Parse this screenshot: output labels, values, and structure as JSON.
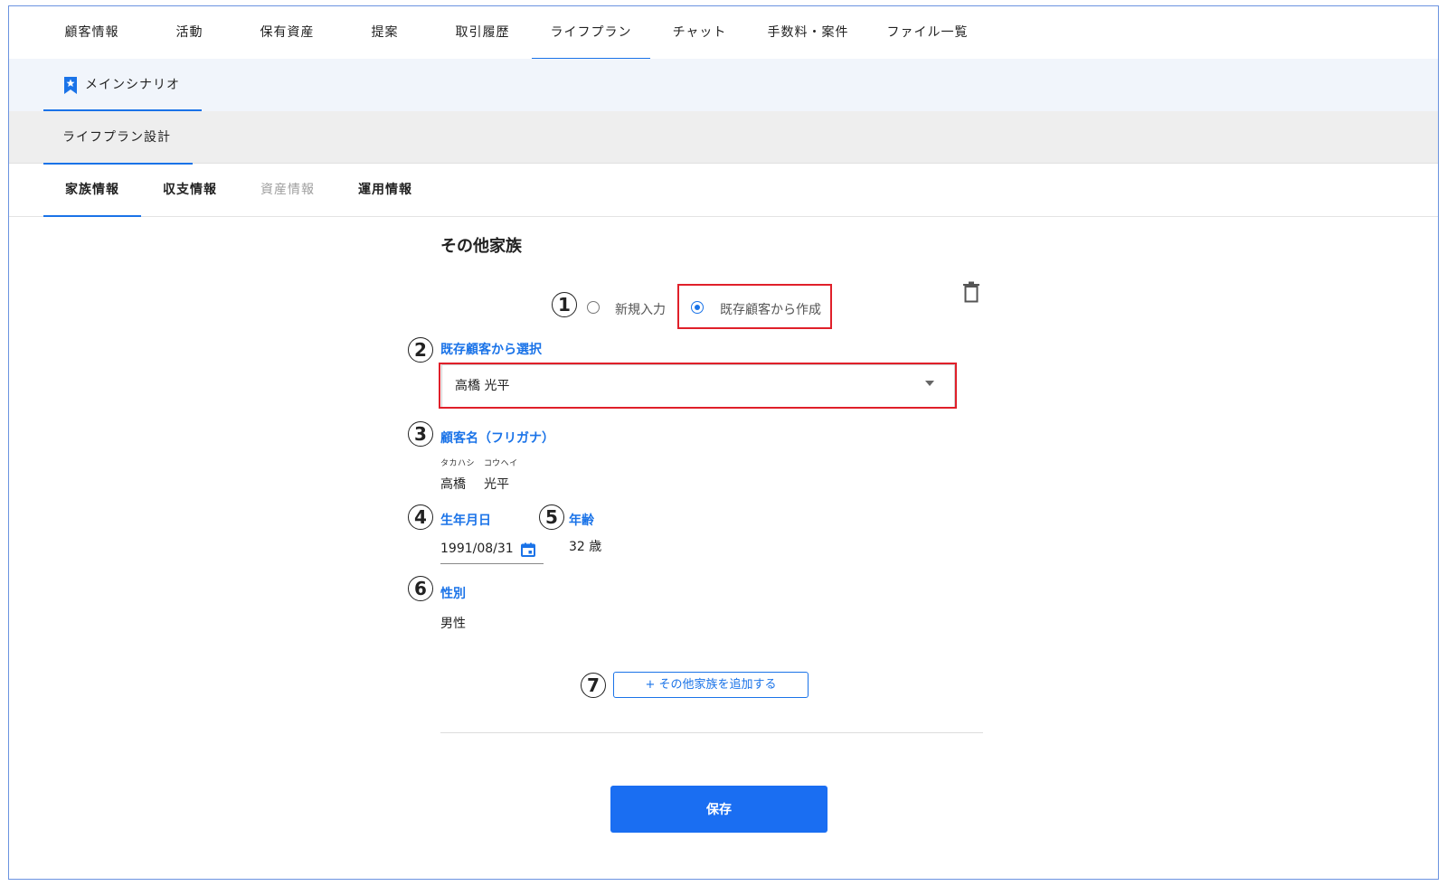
{
  "top_tabs": [
    {
      "label": "顧客情報"
    },
    {
      "label": "活動"
    },
    {
      "label": "保有資産"
    },
    {
      "label": "提案"
    },
    {
      "label": "取引履歴"
    },
    {
      "label": "ライフプラン",
      "active": true
    },
    {
      "label": "チャット"
    },
    {
      "label": "手数料・案件"
    },
    {
      "label": "ファイル一覧"
    }
  ],
  "scenario": {
    "label": "メインシナリオ",
    "icon": "bookmark-star-icon"
  },
  "design": {
    "label": "ライフプラン設計"
  },
  "sub_tabs": [
    {
      "label": "家族情報",
      "active": true
    },
    {
      "label": "収支情報"
    },
    {
      "label": "資産情報",
      "disabled": true
    },
    {
      "label": "運用情報"
    }
  ],
  "form": {
    "section_title": "その他家族",
    "radio_new": "新規入力",
    "radio_existing": "既存顧客から作成",
    "selected_option": "existing",
    "select_label": "既存顧客から選択",
    "select_value": "高橋 光平",
    "name_label": "顧客名（フリガナ）",
    "kana_last": "タカハシ",
    "kana_first": "コウヘイ",
    "name_last": "高橋",
    "name_first": "光平",
    "birth_label": "生年月日",
    "birth_value": "1991/08/31",
    "age_label": "年齢",
    "age_value": "32 歳",
    "gender_label": "性別",
    "gender_value": "男性",
    "add_button": "+ その他家族を追加する",
    "save_button": "保存"
  },
  "annotations": [
    "1",
    "2",
    "3",
    "4",
    "5",
    "6",
    "7"
  ],
  "colors": {
    "accent": "#1a73e8",
    "highlight": "#e0202a",
    "save": "#1a6ef2"
  }
}
